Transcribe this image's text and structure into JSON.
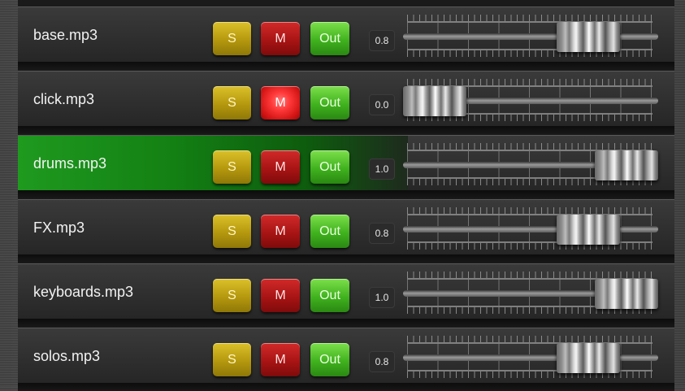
{
  "mixer": {
    "solo_label": "S",
    "mute_label": "M",
    "out_label": "Out",
    "tracks": [
      {
        "name": "base.mp3",
        "value": "0.8",
        "level": 0.8,
        "selected": false,
        "mute_lit": false
      },
      {
        "name": "click.mp3",
        "value": "0.0",
        "level": 0.0,
        "selected": false,
        "mute_lit": true
      },
      {
        "name": "drums.mp3",
        "value": "1.0",
        "level": 1.0,
        "selected": true,
        "mute_lit": false
      },
      {
        "name": "FX.mp3",
        "value": "0.8",
        "level": 0.8,
        "selected": false,
        "mute_lit": false
      },
      {
        "name": "keyboards.mp3",
        "value": "1.0",
        "level": 1.0,
        "selected": false,
        "mute_lit": false
      },
      {
        "name": "solos.mp3",
        "value": "0.8",
        "level": 0.8,
        "selected": false,
        "mute_lit": false
      }
    ]
  },
  "colors": {
    "selected_row": "#138013",
    "solo": "#c9ac17",
    "mute": "#b81818",
    "mute_lit": "#ff3838",
    "out": "#45b822"
  }
}
